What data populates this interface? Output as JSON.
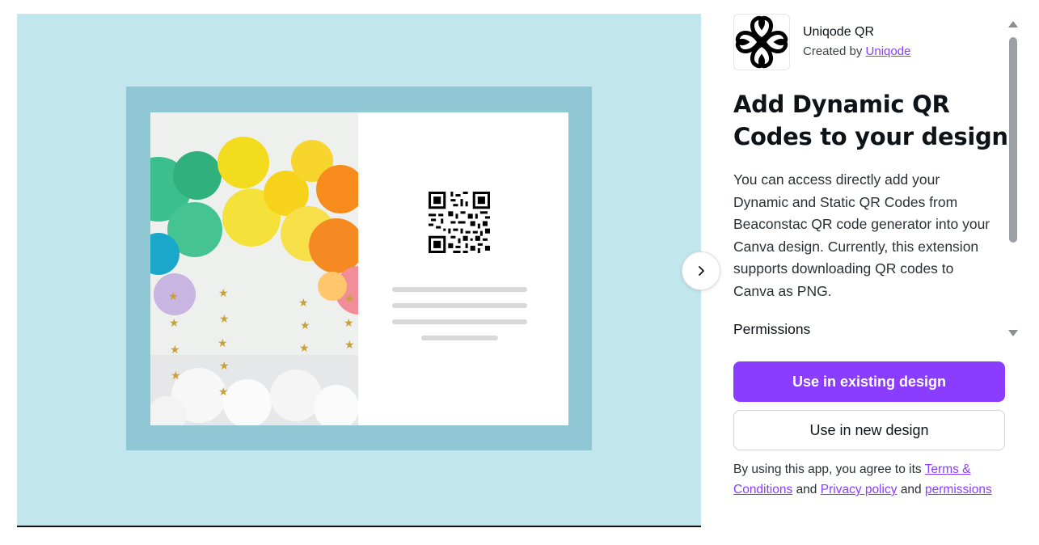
{
  "app": {
    "name": "Uniqode QR",
    "created_by_prefix": "Created by",
    "creator": "Uniqode",
    "logo_icon": "uniqode-flower-logo-icon"
  },
  "headline": "Add Dynamic QR Codes to your design",
  "description": "You can access directly add your Dynamic and Static QR Codes from Beaconstac QR code generator into your Canva design. Currently, this extension supports downloading QR codes to Canva as PNG.",
  "permissions_title": "Permissions",
  "buttons": {
    "existing": "Use in existing design",
    "new": "Use in new design"
  },
  "terms": {
    "prefix": "By using this app, you agree to its",
    "terms_link": "Terms & Conditions",
    "and1": "and",
    "privacy_link": "Privacy policy",
    "and2": "and",
    "permissions_link": "permissions"
  },
  "colors": {
    "accent": "#8b3dff",
    "preview_bg": "#c2e6ee",
    "frame": "#8fc7d5"
  },
  "icons": {
    "next": "chevron-right-icon",
    "scroll_up": "caret-up-icon",
    "scroll_down": "caret-down-icon"
  }
}
